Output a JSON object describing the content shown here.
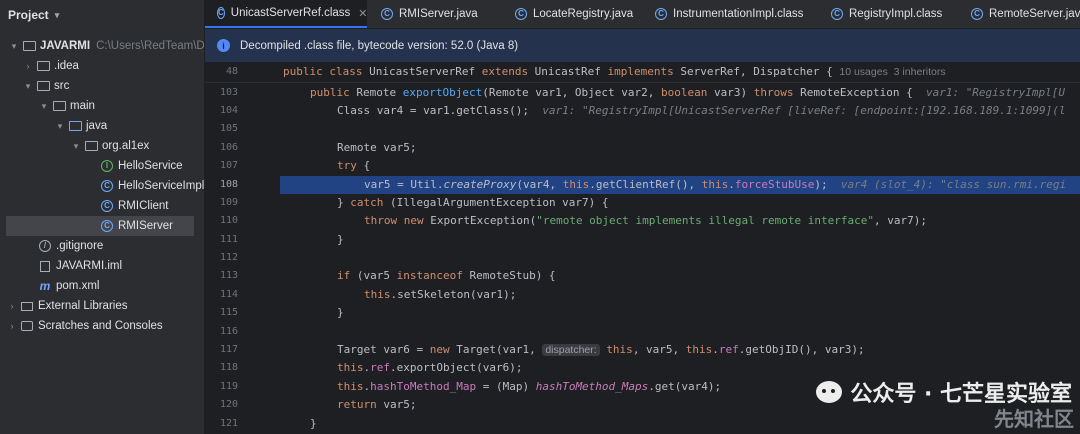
{
  "project": {
    "title": "Project",
    "root_name": "JAVARMI",
    "root_path": "C:\\Users\\RedTeam\\Des",
    "tree": [
      {
        "label": "JAVARMI",
        "hint": "C:\\Users\\RedTeam\\Des",
        "icon": "folder-icon"
      },
      {
        "label": ".idea",
        "icon": "folder-icon"
      },
      {
        "label": "src",
        "icon": "folder-icon"
      },
      {
        "label": "main",
        "icon": "folder-icon"
      },
      {
        "label": "java",
        "icon": "source-folder-icon"
      },
      {
        "label": "org.al1ex",
        "icon": "package-icon"
      },
      {
        "label": "HelloService",
        "icon": "interface-icon"
      },
      {
        "label": "HelloServiceImpl",
        "icon": "class-icon"
      },
      {
        "label": "RMIClient",
        "icon": "class-icon"
      },
      {
        "label": "RMIServer",
        "icon": "class-icon"
      },
      {
        "label": ".gitignore",
        "icon": "gitignore-icon"
      },
      {
        "label": "JAVARMI.iml",
        "icon": "module-file-icon"
      },
      {
        "label": "pom.xml",
        "icon": "maven-icon"
      },
      {
        "label": "External Libraries",
        "icon": "libraries-icon"
      },
      {
        "label": "Scratches and Consoles",
        "icon": "scratches-icon"
      }
    ]
  },
  "tabs": [
    {
      "label": "UnicastServerRef.class"
    },
    {
      "label": "RMIServer.java"
    },
    {
      "label": "LocateRegistry.java"
    },
    {
      "label": "InstrumentationImpl.class"
    },
    {
      "label": "RegistryImpl.class"
    },
    {
      "label": "RemoteServer.java"
    }
  ],
  "banner": {
    "text": "Decompiled .class file, bytecode version: 52.0 (Java 8)"
  },
  "editor": {
    "sticky_line_number": "48",
    "sticky_usages": "10 usages",
    "sticky_inheritors": "3 inheritors",
    "line_numbers": [
      "103",
      "104",
      "105",
      "106",
      "107",
      "108",
      "109",
      "110",
      "111",
      "112",
      "113",
      "114",
      "115",
      "116",
      "117",
      "118",
      "119",
      "120",
      "121"
    ],
    "current_line": "108",
    "hints": {
      "var1_a": "var1: \"RegistryImpl[U",
      "var1_b": "var1: \"RegistryImpl[UnicastServerRef [liveRef: [endpoint:[192.168.189.1:1099](l",
      "var4_slot": "var4 (slot_4): \"class sun.rmi.regi",
      "dispatcher": "dispatcher:"
    }
  },
  "watermark": {
    "text": "公众号 · 七芒星实验室",
    "text2": "先知社区"
  },
  "colors": {
    "accent": "#3574f0",
    "highlight": "#214283",
    "banner": "#25324d"
  }
}
